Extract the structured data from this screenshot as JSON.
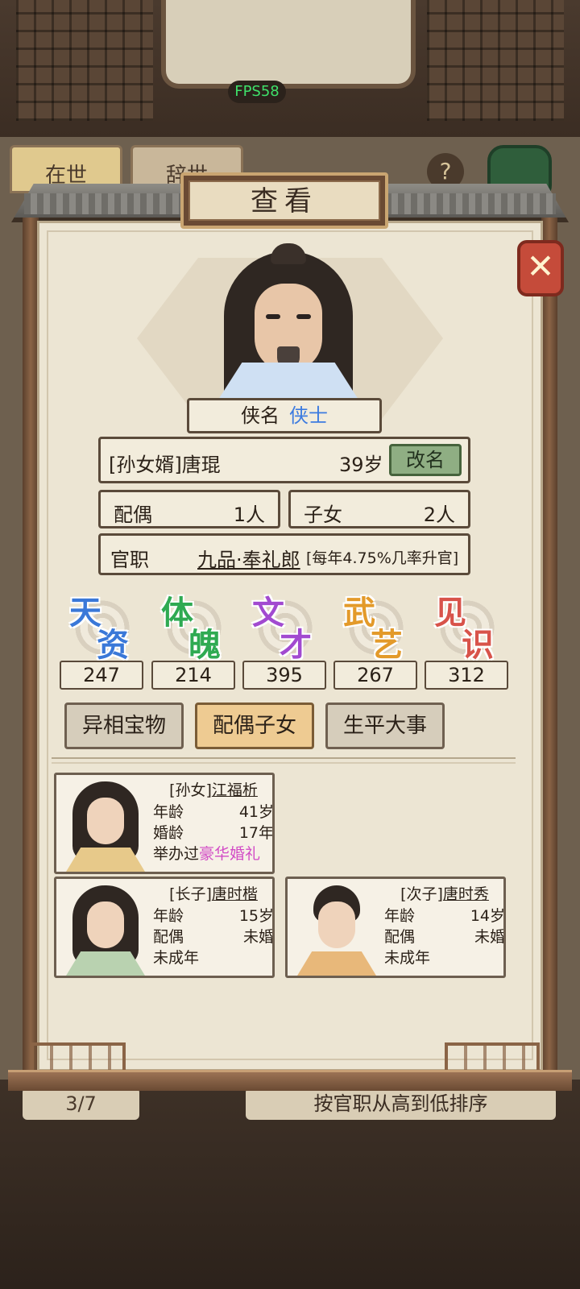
{
  "fps": "FPS58",
  "background": {
    "tabs": [
      "在世",
      "辞世"
    ],
    "help_label": "?",
    "pager": "3/7",
    "sort_label": "按官职从高到低排序"
  },
  "dialog": {
    "title": "查看",
    "close_label": "✕"
  },
  "person": {
    "title_key": "侠名",
    "title_value": "侠士",
    "name": "[孙女婿]唐琨",
    "age": "39岁",
    "rename_label": "改名",
    "spouse_key": "配偶",
    "spouse_value": "1人",
    "children_key": "子女",
    "children_value": "2人",
    "rank_key": "官职",
    "rank_value": "九品·奉礼郎",
    "rank_note": "[每年4.75%几率升官]"
  },
  "attributes": [
    {
      "c1": "天",
      "c2": "资",
      "value": "247",
      "color": "#3a78d8"
    },
    {
      "c1": "体",
      "c2": "魄",
      "value": "214",
      "color": "#2faa52"
    },
    {
      "c1": "文",
      "c2": "才",
      "value": "395",
      "color": "#a24ad0"
    },
    {
      "c1": "武",
      "c2": "艺",
      "value": "267",
      "color": "#e39a2a"
    },
    {
      "c1": "见",
      "c2": "识",
      "value": "312",
      "color": "#d8534a"
    }
  ],
  "tabs": [
    {
      "label": "异相宝物"
    },
    {
      "label": "配偶子女"
    },
    {
      "label": "生平大事"
    }
  ],
  "family": {
    "spouse": {
      "relation": "[孙女]",
      "name": "江福析",
      "age_key": "年龄",
      "age_value": "41岁",
      "marriage_key": "婚龄",
      "marriage_value": "17年",
      "wedding_prefix": "举办过",
      "wedding_type": "豪华婚礼"
    },
    "child1": {
      "relation": "[长子]",
      "name": "唐时楷",
      "age_key": "年龄",
      "age_value": "15岁",
      "spouse_key": "配偶",
      "spouse_value": "未婚",
      "status": "未成年"
    },
    "child2": {
      "relation": "[次子]",
      "name": "唐时秀",
      "age_key": "年龄",
      "age_value": "14岁",
      "spouse_key": "配偶",
      "spouse_value": "未婚",
      "status": "未成年"
    }
  },
  "colors": {
    "accent_blue": "#3c7be0",
    "wedding_pink": "#d24bc6",
    "active_tab": "#eecb92",
    "rename_green": "#8fae83"
  }
}
